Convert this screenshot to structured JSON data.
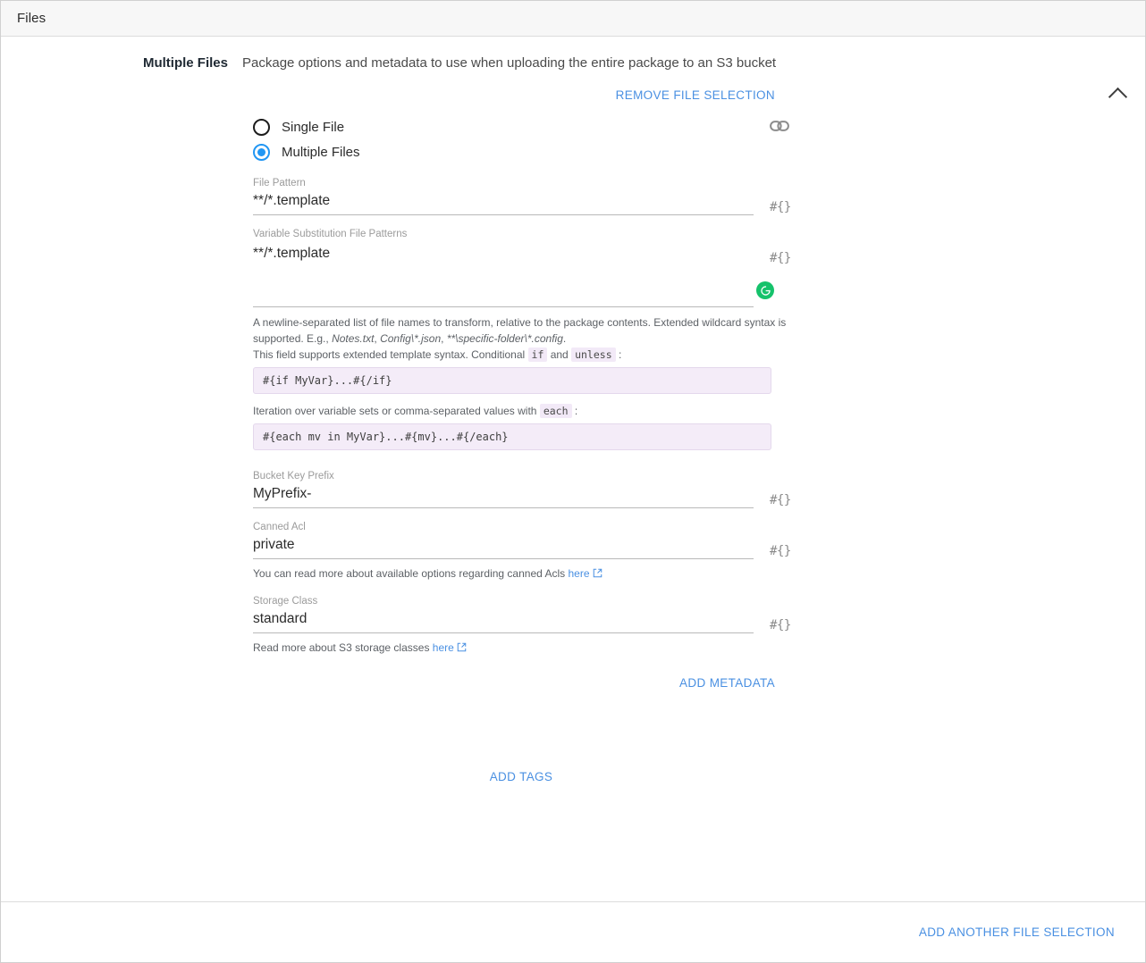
{
  "topbar": {
    "title": "Files"
  },
  "panel": {
    "label": "Multiple Files",
    "description": "Package options and metadata to use when uploading the entire package to an S3 bucket",
    "collapse_icon": "chevron-up-icon",
    "remove_label": "REMOVE FILE SELECTION"
  },
  "selection_mode": {
    "link_icon": "chain-link-icon",
    "options": [
      {
        "label": "Single File",
        "selected": false
      },
      {
        "label": "Multiple Files",
        "selected": true
      }
    ]
  },
  "fields": {
    "file_pattern": {
      "label": "File Pattern",
      "value": "**/*.template",
      "placeholder": "",
      "token": "#{}"
    },
    "variable_substitution": {
      "label": "Variable Substitution File Patterns",
      "value": "**/*.template",
      "placeholder": "",
      "token": "#{}",
      "grammarly_icon": "grammarly-icon"
    },
    "bucket_key_prefix": {
      "label": "Bucket Key Prefix",
      "value": "MyPrefix-",
      "placeholder": "",
      "token": "#{}"
    },
    "canned_acl": {
      "label": "Canned Acl",
      "value": "private",
      "placeholder": "",
      "token": "#{}",
      "helper_prefix": "You can read more about available options regarding canned Acls ",
      "helper_link": "here"
    },
    "storage_class": {
      "label": "Storage Class",
      "value": "standard",
      "placeholder": "",
      "token": "#{}",
      "helper_prefix": "Read more about S3 storage classes ",
      "helper_link": "here"
    }
  },
  "helper": {
    "line1": "A newline-separated list of file names to transform, relative to the package contents. Extended wildcard syntax is supported. E.g., ",
    "example1": "Notes.txt",
    "sep1": ", ",
    "example2": "Config\\*.json",
    "sep2": ", ",
    "example3": "**\\specific-folder\\*.config",
    "end1": ".",
    "line2_a": "This field supports extended template syntax. Conditional ",
    "code_if": "if",
    "line2_b": " and ",
    "code_unless": "unless",
    "line2_c": " :",
    "block_if": "#{if MyVar}...#{/if}",
    "line3_a": "Iteration over variable sets or comma-separated values with ",
    "code_each": "each",
    "line3_b": " :",
    "block_each": "#{each mv in MyVar}...#{mv}...#{/each}"
  },
  "actions": {
    "add_metadata": "ADD METADATA",
    "add_tags": "ADD TAGS",
    "add_another_file_selection": "ADD ANOTHER FILE SELECTION"
  },
  "colors": {
    "accent_link": "#4a90e2",
    "radio_selected": "#2196f3",
    "grammarly_green": "#15c26b",
    "code_bg": "#f4ecf8",
    "topbar_bg": "#f7f7f7"
  }
}
